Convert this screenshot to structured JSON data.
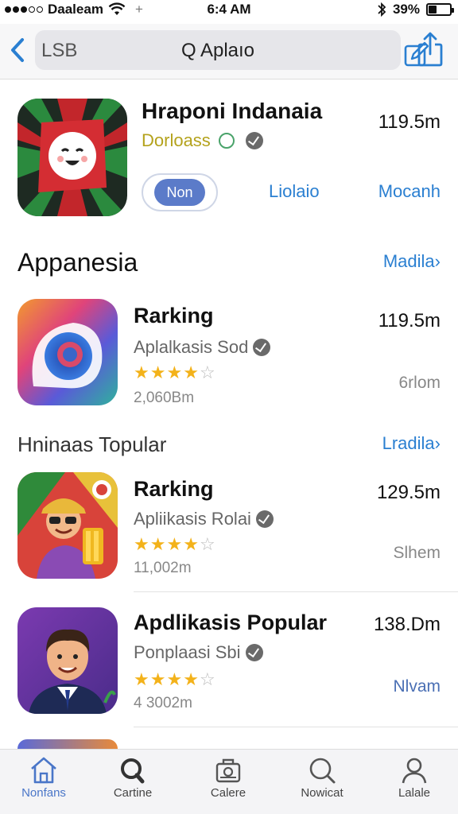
{
  "status_bar": {
    "carrier": "Daaleam",
    "time": "6:4 AM",
    "battery": "39%",
    "battery_fraction": 0.39
  },
  "nav": {
    "left_label": "LSB",
    "search_text": "Q Aplaıo",
    "icons": [
      "chevron-left-icon",
      "edit-icon",
      "share-icon"
    ]
  },
  "featured": {
    "title": "Hraponi Indanaia",
    "subtitle": "Dorloass",
    "size": "119.5m",
    "button_label": "Non",
    "link1": "Liolaio",
    "link2": "Mocanh"
  },
  "sections": {
    "s1_title": "Appanesia",
    "s1_link": "Madila›",
    "s2_title": "Hninaas Topular",
    "s2_link": "Lradila›"
  },
  "apps": [
    {
      "title": "Rarking",
      "subtitle": "Aplalkasis Sod",
      "rating": 4,
      "count": "2,060Bm",
      "size": "119.5m",
      "action": "6rlom"
    },
    {
      "title": "Rarking",
      "subtitle": "Apliikasis Rolai",
      "rating": 4,
      "count": "11,002m",
      "size": "129.5m",
      "action": "Slhem"
    },
    {
      "title": "Apdlikasis Popular",
      "subtitle": "Ponplaasi Sbi",
      "rating": 4,
      "count": "4 3002m",
      "size": "138.Dm",
      "action": "Nlvam"
    }
  ],
  "tabs": [
    {
      "label": "Nonfans",
      "icon": "home-icon"
    },
    {
      "label": "Cartine",
      "icon": "search-icon"
    },
    {
      "label": "Calere",
      "icon": "briefcase-icon"
    },
    {
      "label": "Nowicat",
      "icon": "magnifier-icon"
    },
    {
      "label": "Lalale",
      "icon": "person-icon"
    }
  ],
  "colors": {
    "accent": "#2a7fd1",
    "star": "#f3b21a",
    "button": "#5b7bc9"
  }
}
